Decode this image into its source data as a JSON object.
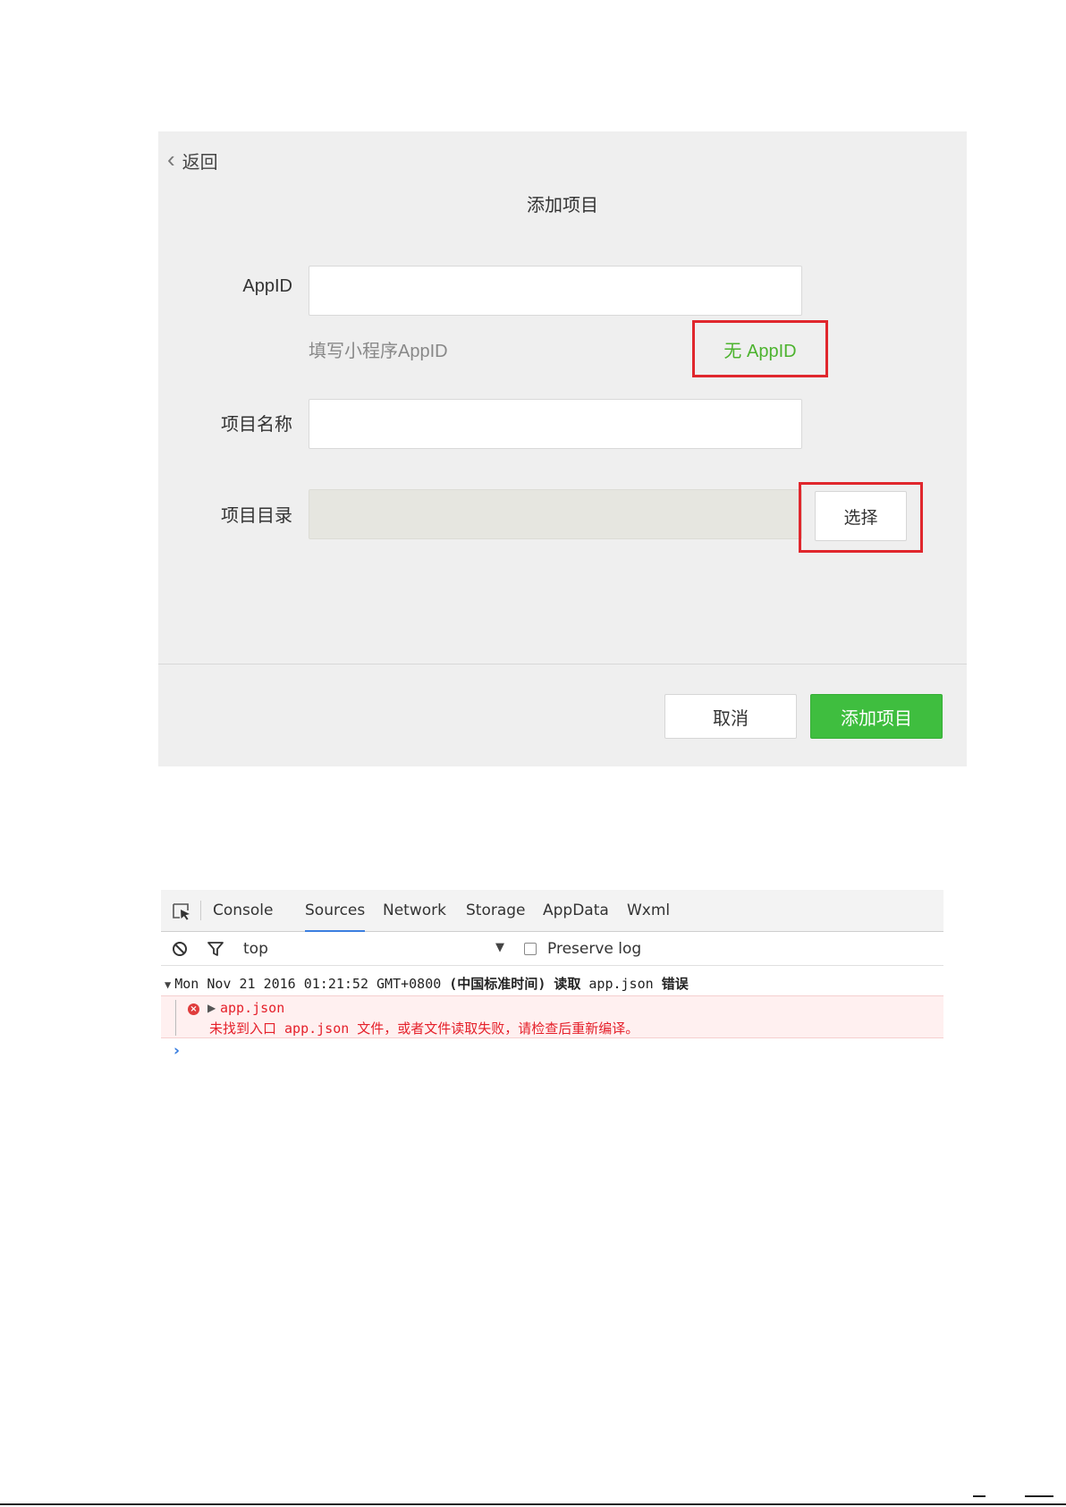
{
  "dialog": {
    "back_label": "返回",
    "title": "添加项目",
    "appid_label": "AppID",
    "appid_value": "",
    "appid_hint": "填写小程序AppID",
    "no_appid_link": "无 AppID",
    "name_label": "项目名称",
    "name_value": "",
    "dir_label": "项目目录",
    "dir_value": "",
    "choose_label": "选择",
    "cancel_label": "取消",
    "add_label": "添加项目"
  },
  "devtools": {
    "tabs": [
      "Console",
      "Sources",
      "Network",
      "Storage",
      "AppData",
      "Wxml"
    ],
    "active_tab": "Sources",
    "context": "top",
    "preserve_log_label": "Preserve log",
    "preserve_log_checked": false,
    "log_header_prefix": "Mon Nov 21 2016 01:21:52 GMT+0800 ",
    "log_header_tz": "(中国标准时间) 读取",
    "log_header_file": " app.json ",
    "log_header_suffix": "错误",
    "error_file": "app.json",
    "error_message": "未找到入口 app.json 文件，或者文件读取失败，请检查后重新编译。",
    "prompt": "›"
  },
  "colors": {
    "highlight_red": "#e0272d",
    "accent_green": "#3fbe3f",
    "link_green": "#4cb32e",
    "error_red": "#e5202a",
    "tab_active_blue": "#3b7fe0"
  }
}
